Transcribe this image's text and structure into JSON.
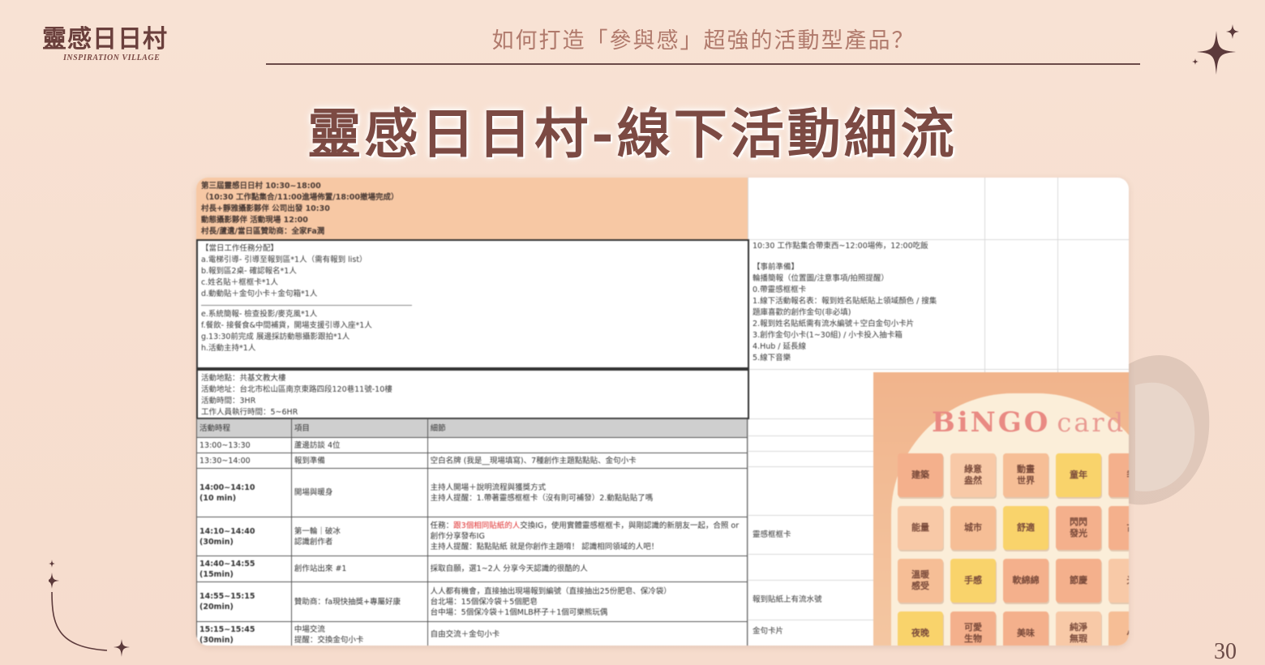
{
  "header": {
    "logo_cn": "靈感日日村",
    "logo_en": "INSPIRATION VILLAGE",
    "subtitle": "如何打造「參與感」超強的活動型產品？"
  },
  "title": "靈感日日村-線下活動細流",
  "page_number": "30",
  "sheet": {
    "header_lines": [
      "第三屆靈感日日村 10:30~18:00",
      "（10:30 工作點集合/11:00進場佈置/18:00撤場完成）",
      "村長+靜雅攝影夥伴 公司出發 10:30",
      "動態攝影夥伴 活動現場 12:00",
      "村長/蘆遺/當日區贊助商：全家Fa潤"
    ],
    "tasks": [
      "【當日工作任務分配】",
      "a.電梯引導- 引導至報到區*1人（需有報到 list）",
      "b.報到區2桌- 確認報名*1人",
      "c.姓名貼＋框框卡*1人",
      "d.動動貼＋金句小卡＋金句箱*1人",
      "",
      "e.系統簡報- 檢查投影/麥克風*1人",
      "f.餐飲- 接餐食&中間補貨，開場支援引導入座*1人",
      "g.13:30前完成 展邊採訪動態攝影跟拍*1人",
      "h.活動主持*1人"
    ],
    "venue": [
      "活動地點：共基文教大樓",
      "活動地址：台北市松山區南京東路四段120巷11號-10樓",
      "活動時間：3HR",
      "工作人員執行時間：5~6HR"
    ],
    "schedule_headers": [
      "活動時程",
      "項目",
      "細節"
    ],
    "schedule": [
      {
        "time": "13:00~13:30",
        "item": "蘆邊訪談 4位",
        "detail": ""
      },
      {
        "time": "13:30~14:00",
        "item": "報到準備",
        "detail": "空白名牌 (我是__現場填寫)、7種創作主題點點貼、金句小卡"
      },
      {
        "time": "14:00~14:10\n(10 min)",
        "item": "開場與暖身",
        "detail": "主持人開場＋說明流程與獲獎方式\n主持人提醒：1.帶著靈感框框卡（沒有則可補發）2.動點貼貼了嗎"
      },
      {
        "time": "14:10~14:40\n(30min)",
        "item": "第一輪｜破冰\n認識創作者",
        "detail_pre": "任務：",
        "detail_red": "跟3個相同貼紙的人",
        "detail_post": "交換IG，使用實體靈感框框卡，與剛認識的新朋友一起，合照 or 創作分享發布IG\n主持人提醒：點點貼紙 就是你創作主題唷！ 認識相同領域的人吧！"
      },
      {
        "time": "14:40~14:55\n(15min)",
        "item": "創作站出來 #1",
        "detail": "採取自願，選1~2人 分享今天認識的很酷的人"
      },
      {
        "time": "14:55~15:15\n(20min)",
        "item": "贊助商：fa現快抽獎+專屬好康",
        "detail": "人人都有機會，直接抽出現場報到編號（直接抽出25份肥皂、保冷袋）\n台北場：15個保冷袋＋5個肥皂\n台中場：5個保冷袋＋1個MLB杯子＋1個可樂熊玩偶"
      },
      {
        "time": "15:15~15:45\n(30min)",
        "item": "中場交流\n提醒：交換金句小卡",
        "detail": "自由交流＋金句小卡"
      }
    ],
    "right_col": {
      "line1": "10:30 工作點集合帶東西~12:00場佈，12:00吃飯",
      "prep": [
        "【事前準備】",
        "輪播簡報（位置圖/注意事項/拍照提醒）",
        "0.帶靈感框框卡",
        "1.線下活動報名表：報到姓名貼紙貼上領域顏色 / 搜集",
        "題庫喜歡的創作金句(非必填)",
        "2.報到姓名貼紙需有流水編號＋空白金句小卡片",
        "3.創作金句小卡(1~30組) / 小卡投入抽卡箱",
        "4.Hub / 延長線",
        "5.線下音樂"
      ],
      "note_a": "靈感框框卡",
      "note_b": "報到貼紙上有流水號",
      "note_c": "金句卡片"
    },
    "bingo": {
      "title": "BiNGO",
      "card_word": "card",
      "tiles": [
        "建築",
        "綠意\n盎然",
        "動畫\n世界",
        "童年",
        "季",
        "能量",
        "城市",
        "舒適",
        "閃閃\n發光",
        "古",
        "溫暖\n感受",
        "手感",
        "軟綿綿",
        "節慶",
        "光",
        "夜晚",
        "可愛\n生物",
        "美味",
        "純淨\n無瑕",
        "小"
      ]
    }
  }
}
